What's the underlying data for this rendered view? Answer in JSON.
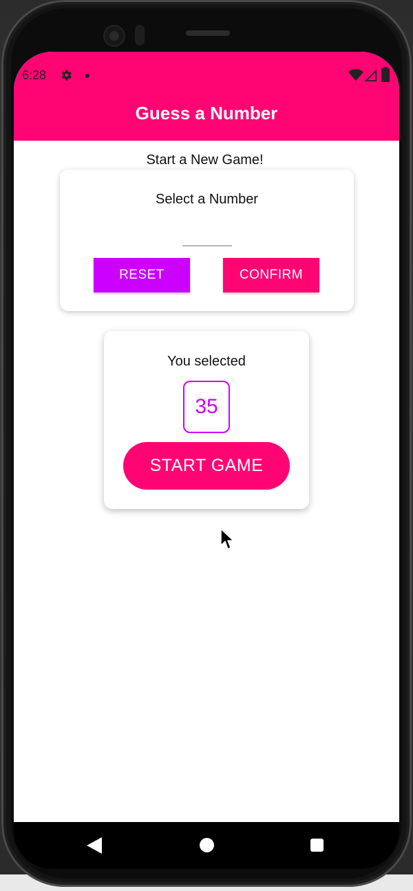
{
  "status_bar": {
    "time": "6:28",
    "icons": [
      "gear-icon",
      "notification-dot-icon",
      "wifi-icon",
      "signal-icon",
      "battery-icon"
    ]
  },
  "header": {
    "title": "Guess a Number",
    "background_color": "#ff0473"
  },
  "main": {
    "subtitle": "Start a New Game!",
    "input_card": {
      "label": "Select a Number",
      "input_value": "",
      "reset_label": "RESET",
      "confirm_label": "CONFIRM"
    },
    "selected_card": {
      "label": "You selected",
      "number": "35",
      "start_label": "START GAME"
    }
  },
  "navigation": {
    "icons": [
      "back-icon",
      "home-icon",
      "recents-icon"
    ]
  },
  "colors": {
    "primary": "#ff0473",
    "accent": "#cc00ff"
  }
}
